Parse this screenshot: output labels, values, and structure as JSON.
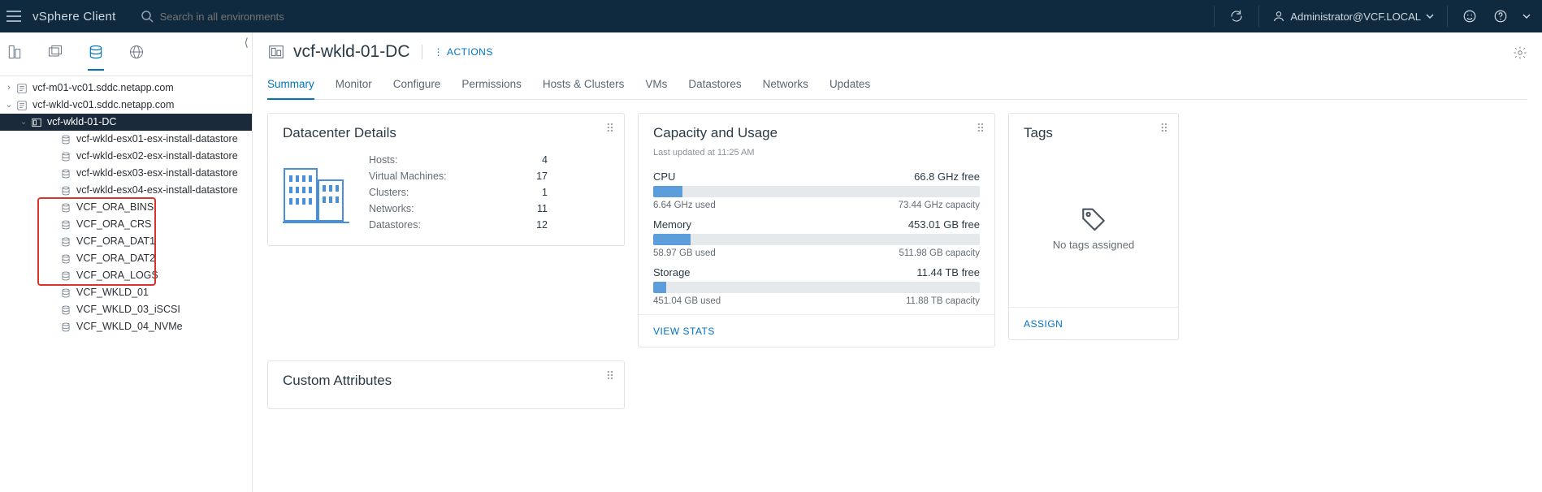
{
  "topbar": {
    "app_title": "vSphere Client",
    "search_placeholder": "Search in all environments",
    "user_label": "Administrator@VCF.LOCAL",
    "icons": {
      "refresh": "refresh",
      "user": "user",
      "smiley": "smiley",
      "help": "help"
    }
  },
  "sidebar": {
    "tree": [
      {
        "id": "root1",
        "label": "vcf-m01-vc01.sddc.netapp.com",
        "level": 0,
        "icon": "vcenter",
        "expander": ">"
      },
      {
        "id": "root2",
        "label": "vcf-wkld-vc01.sddc.netapp.com",
        "level": 0,
        "icon": "vcenter",
        "expander": "v"
      },
      {
        "id": "dc1",
        "label": "vcf-wkld-01-DC",
        "level": 1,
        "icon": "datacenter",
        "expander": "v",
        "selected": true
      },
      {
        "id": "ds1",
        "label": "vcf-wkld-esx01-esx-install-datastore",
        "level": 3,
        "icon": "db"
      },
      {
        "id": "ds2",
        "label": "vcf-wkld-esx02-esx-install-datastore",
        "level": 3,
        "icon": "db"
      },
      {
        "id": "ds3",
        "label": "vcf-wkld-esx03-esx-install-datastore",
        "level": 3,
        "icon": "db"
      },
      {
        "id": "ds4",
        "label": "vcf-wkld-esx04-esx-install-datastore",
        "level": 3,
        "icon": "db"
      },
      {
        "id": "ds5",
        "label": "VCF_ORA_BINS",
        "level": 3,
        "icon": "db"
      },
      {
        "id": "ds6",
        "label": "VCF_ORA_CRS",
        "level": 3,
        "icon": "db"
      },
      {
        "id": "ds7",
        "label": "VCF_ORA_DAT1",
        "level": 3,
        "icon": "db"
      },
      {
        "id": "ds8",
        "label": "VCF_ORA_DAT2",
        "level": 3,
        "icon": "db"
      },
      {
        "id": "ds9",
        "label": "VCF_ORA_LOGS",
        "level": 3,
        "icon": "db"
      },
      {
        "id": "ds10",
        "label": "VCF_WKLD_01",
        "level": 3,
        "icon": "db"
      },
      {
        "id": "ds11",
        "label": "VCF_WKLD_03_iSCSI",
        "level": 3,
        "icon": "db"
      },
      {
        "id": "ds12",
        "label": "VCF_WKLD_04_NVMe",
        "level": 3,
        "icon": "db"
      }
    ]
  },
  "main": {
    "title": "vcf-wkld-01-DC",
    "actions_label": "ACTIONS",
    "tabs": [
      "Summary",
      "Monitor",
      "Configure",
      "Permissions",
      "Hosts & Clusters",
      "VMs",
      "Datastores",
      "Networks",
      "Updates"
    ],
    "active_tab": "Summary",
    "cards": {
      "details": {
        "title": "Datacenter Details",
        "rows": [
          {
            "k": "Hosts:",
            "v": "4"
          },
          {
            "k": "Virtual Machines:",
            "v": "17"
          },
          {
            "k": "Clusters:",
            "v": "1"
          },
          {
            "k": "Networks:",
            "v": "11"
          },
          {
            "k": "Datastores:",
            "v": "12"
          }
        ]
      },
      "capacity": {
        "title": "Capacity and Usage",
        "sub": "Last updated at 11:25 AM",
        "metrics": [
          {
            "name": "CPU",
            "free": "66.8 GHz free",
            "used": "6.64 GHz used",
            "cap": "73.44 GHz capacity",
            "pct": 9
          },
          {
            "name": "Memory",
            "free": "453.01 GB free",
            "used": "58.97 GB used",
            "cap": "511.98 GB capacity",
            "pct": 11.5
          },
          {
            "name": "Storage",
            "free": "11.44 TB free",
            "used": "451.04 GB used",
            "cap": "11.88 TB capacity",
            "pct": 4
          }
        ],
        "link": "VIEW STATS"
      },
      "tags": {
        "title": "Tags",
        "empty": "No tags assigned",
        "link": "ASSIGN"
      },
      "custom_attrs": {
        "title": "Custom Attributes"
      }
    }
  }
}
